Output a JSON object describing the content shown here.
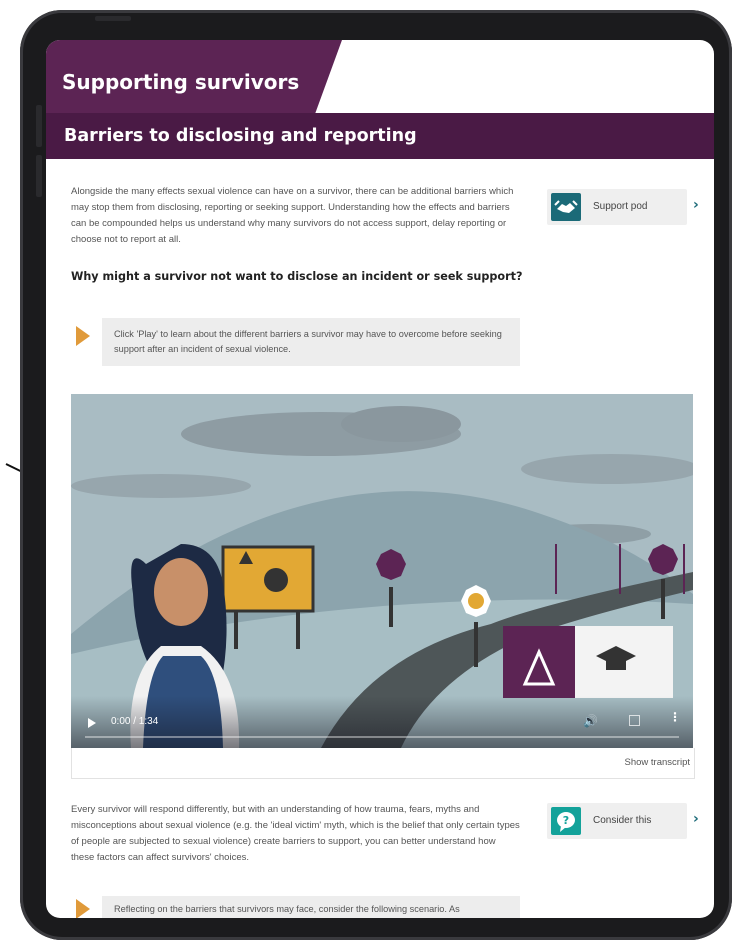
{
  "header": {
    "course_title": "Supporting survivors",
    "section_title": "Barriers to disclosing and reporting"
  },
  "intro": {
    "text": "Alongside the many effects sexual violence can have on a survivor, there can be additional barriers which may stop them from disclosing, reporting or seeking support. Understanding how the effects and barriers can be compounded helps us understand why many survivors do not access support, delay reporting or choose not to report at all.",
    "question": "Why might a survivor not want to disclose an incident or seek support?"
  },
  "support_pod": {
    "label": "Support pod",
    "icon": "handshake-icon",
    "color": "#1b6a78"
  },
  "instruction": {
    "text": "Click 'Play' to learn about the different barriers a survivor may have to overcome before seeking support after an incident of sexual violence."
  },
  "video": {
    "time": "0:00 / 1:34",
    "progress": 0,
    "transcript_label": "Show transcript"
  },
  "followup": {
    "text": "Every survivor will respond differently, but with an understanding of how trauma, fears, myths and misconceptions about sexual violence (e.g. the 'ideal victim' myth, which is the belief that only certain types of people are subjected to sexual violence) create barriers to support, you can better understand how these factors can affect survivors' choices."
  },
  "consider_pod": {
    "label": "Consider this",
    "icon": "question-bubble-icon",
    "color": "#13a29a"
  },
  "scenario_instruction": {
    "text": "Reflecting on the barriers that survivors may face, consider the following scenario. As"
  },
  "colors": {
    "brand": "#5c2454",
    "brand_dark": "#4a1a45",
    "accent": "#e09a3a"
  }
}
